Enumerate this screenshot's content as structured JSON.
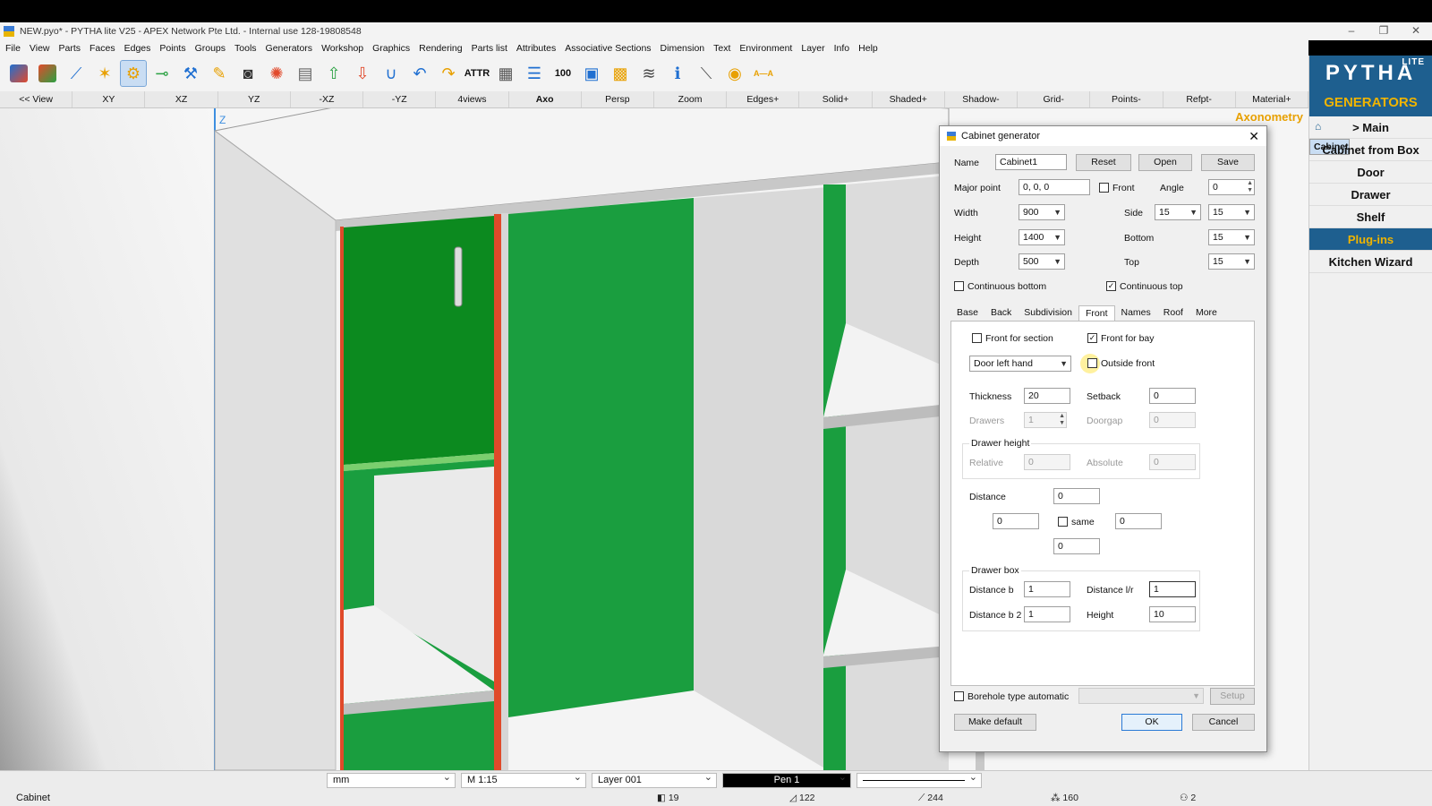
{
  "window": {
    "title": "NEW.pyo* - PYTHA lite V25 -      APEX Network Pte Ltd. - Internal use   128-19808548",
    "minimize": "–",
    "restore": "❐",
    "close": "✕"
  },
  "menu": [
    "File",
    "View",
    "Parts",
    "Faces",
    "Edges",
    "Points",
    "Groups",
    "Tools",
    "Generators",
    "Workshop",
    "Graphics",
    "Rendering",
    "Parts list",
    "Attributes",
    "Associative Sections",
    "Dimension",
    "Text",
    "Environment",
    "Layer",
    "Info",
    "Help"
  ],
  "toolbar_text": {
    "attr": "ATTR",
    "hundred": "100",
    "aa": "A—A"
  },
  "viewbar": [
    "<< View",
    "XY",
    "XZ",
    "YZ",
    "-XZ",
    "-YZ",
    "4views",
    "Axo",
    "Persp",
    "Zoom",
    "Edges+",
    "Solid+",
    "Shaded+",
    "Shadow-",
    "Grid-",
    "Points-",
    "Refpt-",
    "Material+"
  ],
  "viewport": {
    "axis_label": "Z",
    "mode": "Axonometry"
  },
  "right_panel": {
    "logo": "PYTHA",
    "lite": "LITE",
    "header": "GENERATORS",
    "items": [
      "> Main",
      "Cabinet",
      "Cabinet from Box",
      "Door",
      "Drawer",
      "Shelf",
      "Plug-ins",
      "Kitchen Wizard"
    ]
  },
  "dialog": {
    "title": "Cabinet generator",
    "name_label": "Name",
    "name_value": "Cabinet1",
    "reset": "Reset",
    "open": "Open",
    "save": "Save",
    "major_point_label": "Major point",
    "major_point_value": "0, 0, 0",
    "front_label": "Front",
    "angle_label": "Angle",
    "angle_value": "0",
    "width_label": "Width",
    "width_value": "900",
    "height_label": "Height",
    "height_value": "1400",
    "depth_label": "Depth",
    "depth_value": "500",
    "side_label": "Side",
    "side_value1": "15",
    "side_value2": "15",
    "bottom_label": "Bottom",
    "bottom_value": "15",
    "top_label": "Top",
    "top_value": "15",
    "continuous_bottom": "Continuous bottom",
    "continuous_top": "Continuous top",
    "tabs": [
      "Base",
      "Back",
      "Subdivision",
      "Front",
      "Names",
      "Roof",
      "More"
    ],
    "front_for_section": "Front for section",
    "front_for_bay": "Front for bay",
    "front_type": "Door left hand",
    "outside_front": "Outside front",
    "thickness_label": "Thickness",
    "thickness_value": "20",
    "setback_label": "Setback",
    "setback_value": "0",
    "drawers_label": "Drawers",
    "drawers_value": "1",
    "doorgap_label": "Doorgap",
    "doorgap_value": "0",
    "drawer_height_group": "Drawer height",
    "relative_label": "Relative",
    "relative_value": "0",
    "absolute_label": "Absolute",
    "absolute_value": "0",
    "distance_label": "Distance",
    "distance_top": "0",
    "distance_left": "0",
    "distance_right": "0",
    "distance_bottom": "0",
    "same_label": "same",
    "drawer_box_group": "Drawer box",
    "distance_b_label": "Distance b",
    "distance_b_value": "1",
    "distance_lr_label": "Distance l/r",
    "distance_lr_value": "1",
    "distance_b2_label": "Distance b 2",
    "distance_b2_value": "1",
    "box_height_label": "Height",
    "box_height_value": "10",
    "borehole_label": "Borehole type automatic",
    "setup": "Setup",
    "make_default": "Make default",
    "ok": "OK",
    "cancel": "Cancel"
  },
  "statusbar": {
    "unit": "mm",
    "scale": "M 1:15",
    "layer": "Layer 001",
    "pen": "Pen 1",
    "status": "Cabinet",
    "counts": [
      "19",
      "122",
      "244",
      "160",
      "2"
    ]
  },
  "colors": {
    "panel_green": "#1a9e3f",
    "door_green": "#0c8a1f",
    "accent_blue": "#1e5f8f",
    "accent_gold": "#f0b400"
  }
}
